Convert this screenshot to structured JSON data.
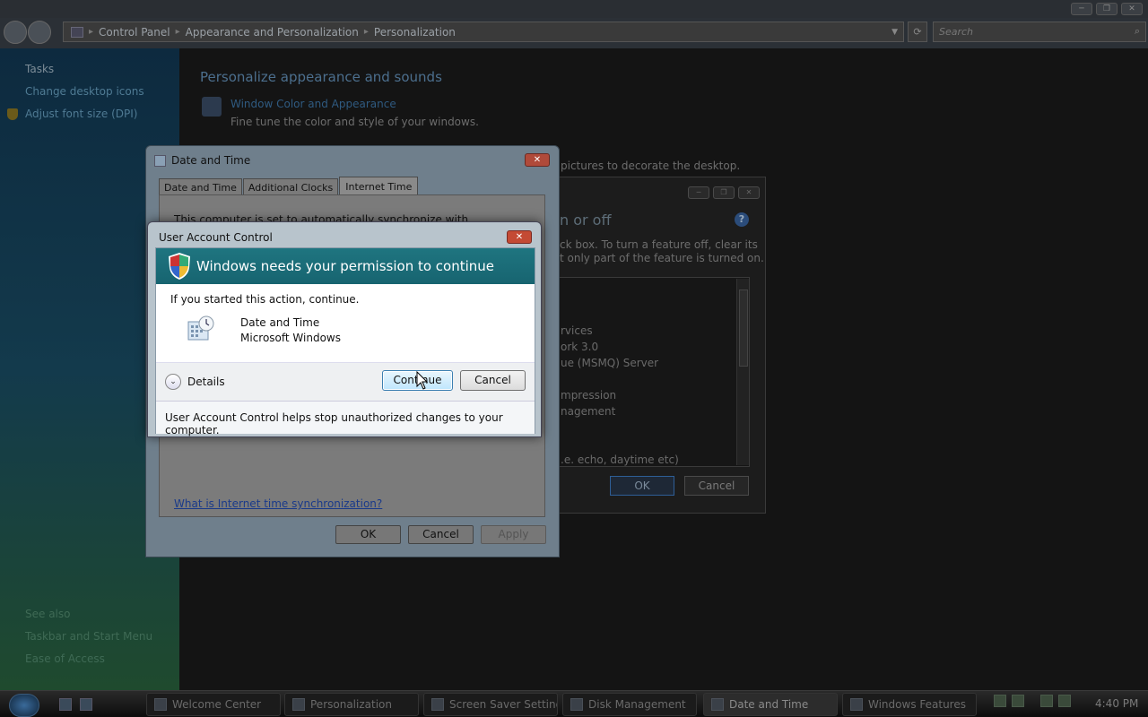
{
  "explorer": {
    "breadcrumb": [
      "Control Panel",
      "Appearance and Personalization",
      "Personalization"
    ],
    "search_placeholder": "Search",
    "sidebar": {
      "tasks_heading": "Tasks",
      "tasks": [
        "Change desktop icons",
        "Adjust font size (DPI)"
      ],
      "see_also_heading": "See also",
      "see_also": [
        "Taskbar and Start Menu",
        "Ease of Access"
      ]
    },
    "main": {
      "title": "Personalize appearance and sounds",
      "window_color_link": "Window Color and Appearance",
      "window_color_desc": "Fine tune the color and style of your windows.",
      "background_desc_fragment": "pictures to decorate the desktop."
    }
  },
  "windows_features": {
    "heading_fragment": "n or off",
    "help_label": "?",
    "intro_line1": "ck box. To turn a feature off, clear its",
    "intro_line2": "t only part of the feature is turned on.",
    "items": [
      "rvices",
      "ork 3.0",
      "ue (MSMQ) Server",
      "mpression",
      "nagement",
      ".e. echo, daytime etc)"
    ],
    "ok_label": "OK",
    "cancel_label": "Cancel"
  },
  "date_time_dialog": {
    "title": "Date and Time",
    "tabs": [
      "Date and Time",
      "Additional Clocks",
      "Internet Time"
    ],
    "active_tab": "Internet Time",
    "sync_text": "This computer is set to automatically synchronize with",
    "help_link": "What is Internet time synchronization?",
    "ok_label": "OK",
    "cancel_label": "Cancel",
    "apply_label": "Apply"
  },
  "uac_dialog": {
    "title": "User Account Control",
    "banner": "Windows needs your permission to continue",
    "started_text": "If you started this action, continue.",
    "program_name": "Date and Time",
    "publisher": "Microsoft Windows",
    "details_label": "Details",
    "continue_label": "Continue",
    "cancel_label": "Cancel",
    "footer": "User Account Control helps stop unauthorized changes to your computer.",
    "banner_color": "#1f7580"
  },
  "taskbar": {
    "items": [
      "Welcome Center",
      "Personalization",
      "Screen Saver Settings",
      "Disk Management",
      "Date and Time",
      "Windows Features"
    ],
    "active_item": "Date and Time",
    "clock": "4:40 PM"
  }
}
